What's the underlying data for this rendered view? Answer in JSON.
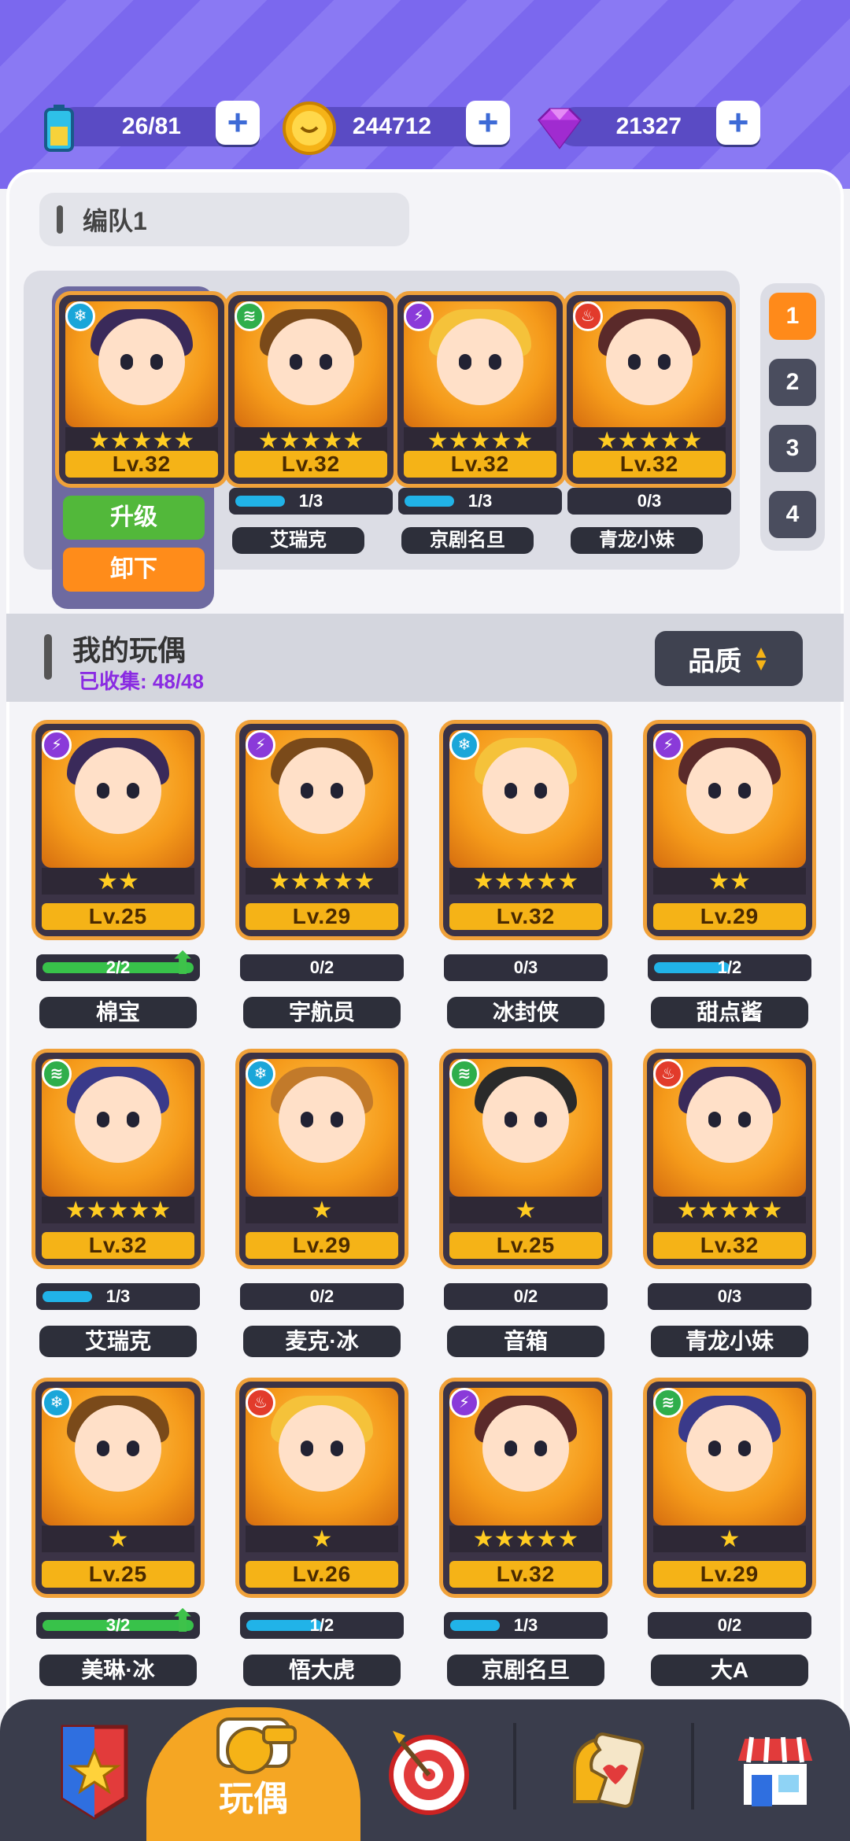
{
  "resources": {
    "energy": {
      "value": "26/81",
      "icon": "battery-icon"
    },
    "coins": {
      "value": "244712",
      "icon": "coin-icon"
    },
    "gems": {
      "value": "21327",
      "icon": "diamond-icon"
    }
  },
  "team": {
    "name": "编队1",
    "tabs": [
      "1",
      "2",
      "3",
      "4"
    ],
    "active_tab": "1",
    "upgrade_label": "升级",
    "unload_label": "卸下",
    "members": [
      {
        "element": "ice",
        "stars": 5,
        "level": "Lv.32",
        "progress": "",
        "name": ""
      },
      {
        "element": "wind",
        "stars": 5,
        "level": "Lv.32",
        "progress": "1/3",
        "progress_ratio": 0.33,
        "name": "艾瑞克"
      },
      {
        "element": "lightning",
        "stars": 5,
        "level": "Lv.32",
        "progress": "1/3",
        "progress_ratio": 0.33,
        "name": "京剧名旦"
      },
      {
        "element": "fire",
        "stars": 5,
        "level": "Lv.32",
        "progress": "0/3",
        "progress_ratio": 0,
        "name": "青龙小妹"
      }
    ]
  },
  "collection": {
    "title": "我的玩偶",
    "collected_label": "已收集:",
    "collected_value": "48/48",
    "sort_label": "品质",
    "cards": [
      {
        "element": "lightning",
        "stars": 2,
        "level": "Lv.25",
        "progress": "2/2",
        "progress_ratio": 1,
        "bar_color": "#38c24a",
        "upgrade_arrow": true,
        "name": "棉宝"
      },
      {
        "element": "lightning",
        "stars": 5,
        "level": "Lv.29",
        "progress": "0/2",
        "progress_ratio": 0,
        "bar_color": "#21b3e8",
        "upgrade_arrow": false,
        "name": "宇航员"
      },
      {
        "element": "ice",
        "stars": 5,
        "level": "Lv.32",
        "progress": "0/3",
        "progress_ratio": 0,
        "bar_color": "#21b3e8",
        "upgrade_arrow": false,
        "name": "冰封侠"
      },
      {
        "element": "lightning",
        "stars": 2,
        "level": "Lv.29",
        "progress": "1/2",
        "progress_ratio": 0.5,
        "bar_color": "#21b3e8",
        "upgrade_arrow": false,
        "name": "甜点酱"
      },
      {
        "element": "wind",
        "stars": 5,
        "level": "Lv.32",
        "progress": "1/3",
        "progress_ratio": 0.33,
        "bar_color": "#21b3e8",
        "upgrade_arrow": false,
        "name": "艾瑞克"
      },
      {
        "element": "ice",
        "stars": 1,
        "level": "Lv.29",
        "progress": "0/2",
        "progress_ratio": 0,
        "bar_color": "#21b3e8",
        "upgrade_arrow": false,
        "name": "麦克·冰"
      },
      {
        "element": "wind",
        "stars": 1,
        "level": "Lv.25",
        "progress": "0/2",
        "progress_ratio": 0,
        "bar_color": "#21b3e8",
        "upgrade_arrow": false,
        "name": "音箱"
      },
      {
        "element": "fire",
        "stars": 5,
        "level": "Lv.32",
        "progress": "0/3",
        "progress_ratio": 0,
        "bar_color": "#21b3e8",
        "upgrade_arrow": false,
        "name": "青龙小妹"
      },
      {
        "element": "ice",
        "stars": 1,
        "level": "Lv.25",
        "progress": "3/2",
        "progress_ratio": 1,
        "bar_color": "#38c24a",
        "upgrade_arrow": true,
        "name": "美琳·冰"
      },
      {
        "element": "fire",
        "stars": 1,
        "level": "Lv.26",
        "progress": "1/2",
        "progress_ratio": 0.5,
        "bar_color": "#21b3e8",
        "upgrade_arrow": false,
        "name": "悟大虎"
      },
      {
        "element": "lightning",
        "stars": 5,
        "level": "Lv.32",
        "progress": "1/3",
        "progress_ratio": 0.33,
        "bar_color": "#21b3e8",
        "upgrade_arrow": false,
        "name": "京剧名旦"
      },
      {
        "element": "wind",
        "stars": 1,
        "level": "Lv.29",
        "progress": "0/2",
        "progress_ratio": 0,
        "bar_color": "#21b3e8",
        "upgrade_arrow": false,
        "name": "大A"
      }
    ]
  },
  "nav": {
    "active_label": "玩偶",
    "items": [
      "badge-icon",
      "whistle-icon",
      "target-icon",
      "cards-icon",
      "shop-icon"
    ]
  }
}
